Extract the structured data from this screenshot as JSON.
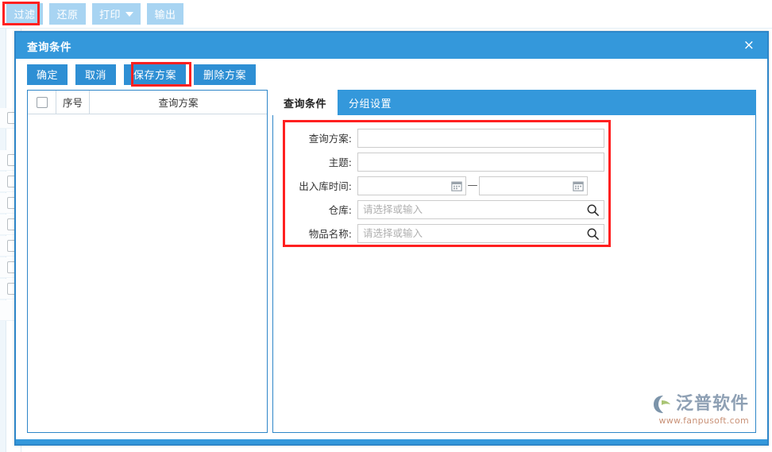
{
  "toolbar": {
    "buttons": [
      {
        "label": "过滤",
        "name": "filter",
        "highlighted": true
      },
      {
        "label": "还原",
        "name": "restore",
        "highlighted": false
      },
      {
        "label": "打印",
        "name": "print",
        "highlighted": false,
        "has_caret": true
      },
      {
        "label": "输出",
        "name": "export",
        "highlighted": false
      }
    ]
  },
  "dialog": {
    "title": "查询条件",
    "close_icon": "×",
    "buttons": [
      {
        "label": "确定",
        "name": "confirm"
      },
      {
        "label": "取消",
        "name": "cancel"
      },
      {
        "label": "保存方案",
        "name": "save-plan",
        "highlighted": true
      },
      {
        "label": "删除方案",
        "name": "delete-plan"
      }
    ],
    "plans_grid": {
      "columns": [
        "",
        "序号",
        "查询方案"
      ],
      "rows": []
    },
    "tabs": [
      {
        "label": "查询条件",
        "active": true
      },
      {
        "label": "分组设置",
        "active": false
      }
    ],
    "form": {
      "fields": [
        {
          "label": "查询方案:",
          "name": "query-plan",
          "value": "",
          "placeholder": "",
          "type": "text"
        },
        {
          "label": "主题:",
          "name": "subject",
          "value": "",
          "placeholder": "",
          "type": "text"
        },
        {
          "label": "出入库时间:",
          "name": "inout-time",
          "type": "daterange",
          "separator": "—",
          "start": {
            "value": "",
            "placeholder": ""
          },
          "end": {
            "value": "",
            "placeholder": ""
          }
        },
        {
          "label": "仓库:",
          "name": "warehouse",
          "value": "",
          "placeholder": "请选择或输入",
          "type": "lookup"
        },
        {
          "label": "物品名称:",
          "name": "item-name",
          "value": "",
          "placeholder": "请选择或输入",
          "type": "lookup"
        }
      ]
    }
  },
  "watermark": {
    "brand": "泛普软件",
    "url": "www.fanpusoft.com"
  },
  "colors": {
    "accent_blue": "#3498db",
    "button_blue": "#2e8fd4",
    "toolbar_button": "#a8d4f2",
    "highlight_red": "#ff2020",
    "border_blue": "#2e86c8"
  }
}
